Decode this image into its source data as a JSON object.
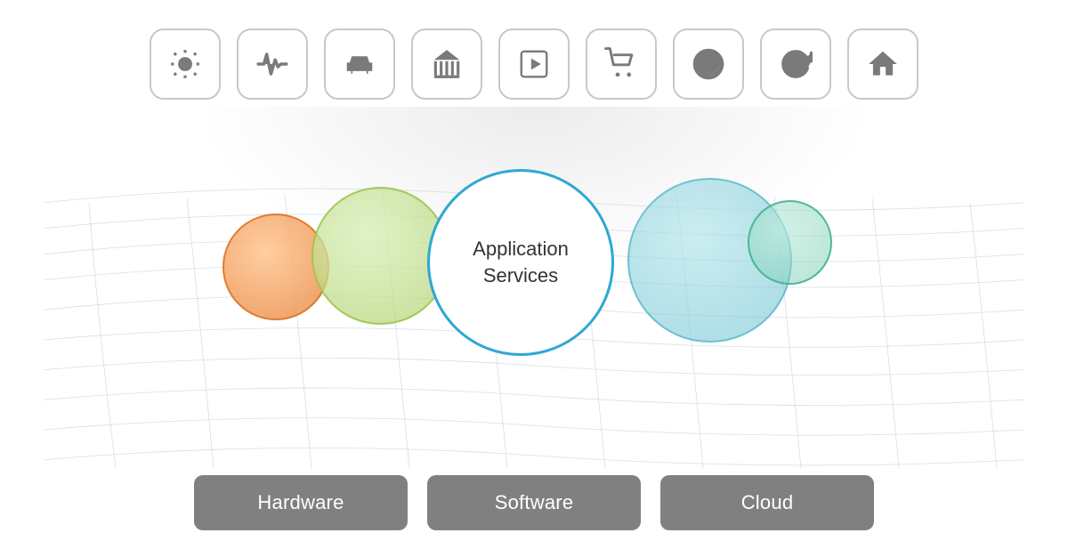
{
  "icons": [
    {
      "name": "sun-icon",
      "label": "Energy/Sun",
      "unicode": "☀"
    },
    {
      "name": "pulse-icon",
      "label": "Health/Pulse"
    },
    {
      "name": "car-icon",
      "label": "Automotive/Car"
    },
    {
      "name": "bank-icon",
      "label": "Finance/Bank"
    },
    {
      "name": "play-icon",
      "label": "Media/Play"
    },
    {
      "name": "cart-icon",
      "label": "Retail/Cart"
    },
    {
      "name": "gauge-icon",
      "label": "Performance/Gauge"
    },
    {
      "name": "refresh-icon",
      "label": "Refresh"
    },
    {
      "name": "home-icon",
      "label": "Home"
    }
  ],
  "center_bubble": {
    "line1": "Application",
    "line2": "Services"
  },
  "buttons": [
    {
      "id": "hardware-btn",
      "label": "Hardware"
    },
    {
      "id": "software-btn",
      "label": "Software"
    },
    {
      "id": "cloud-btn",
      "label": "Cloud"
    }
  ],
  "colors": {
    "icon_border": "#c8c8c8",
    "icon_fill": "#7a7a7a",
    "main_circle_border": "#2fa8d4",
    "button_bg": "#808080",
    "button_text": "#ffffff"
  }
}
